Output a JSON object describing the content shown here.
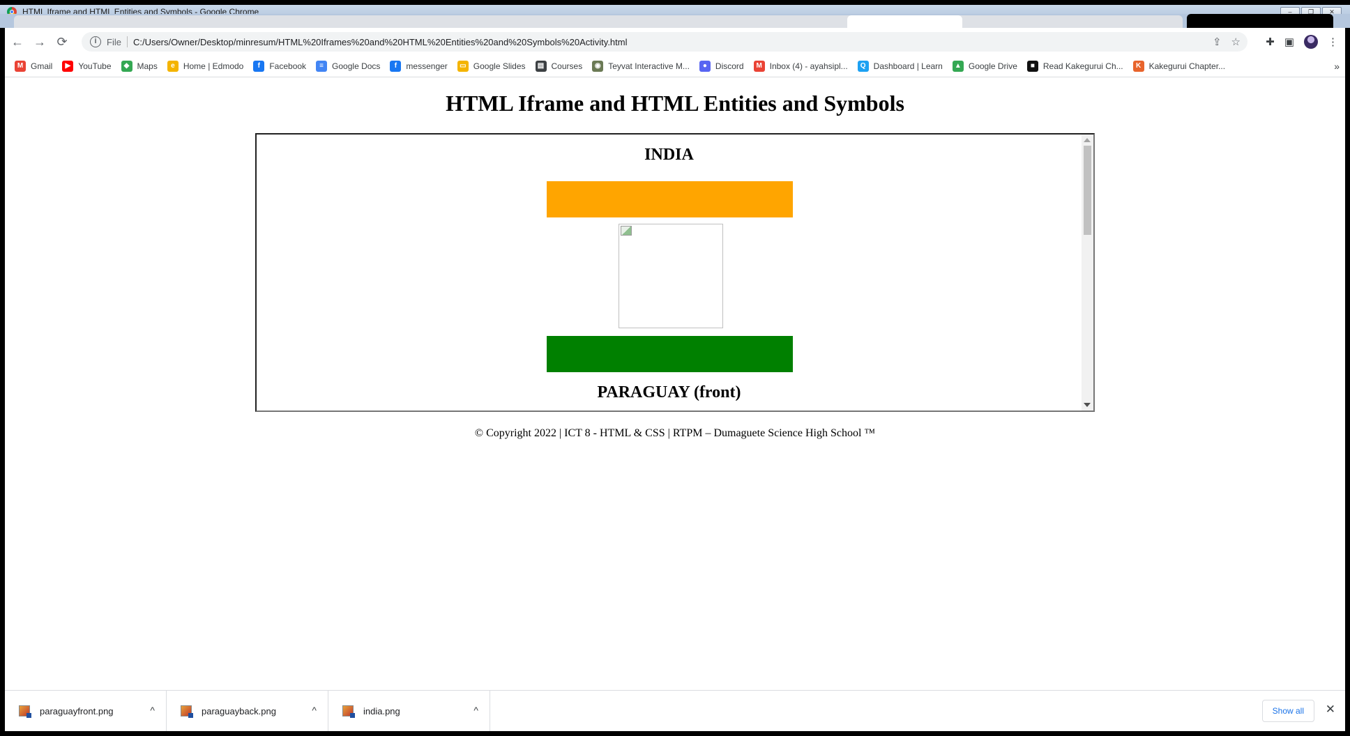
{
  "window": {
    "title": "HTML Iframe and HTML Entities and Symbols - Google Chrome",
    "controls": [
      "–",
      "❐",
      "✕"
    ]
  },
  "toolbar": {
    "back": "←",
    "forward": "→",
    "reload": "⟳",
    "info_icon": "i",
    "protocol": "File",
    "url": "C:/Users/Owner/Desktop/minresum/HTML%20Iframes%20and%20HTML%20Entities%20and%20Symbols%20Activity.html",
    "share": "⇪",
    "star": "☆",
    "extensions": "✚",
    "sidepanel": "▣",
    "menu": "⋮"
  },
  "bookmarks": [
    {
      "label": "Gmail",
      "icon": "M",
      "color": "#ea4335"
    },
    {
      "label": "YouTube",
      "icon": "▶",
      "color": "#ff0000"
    },
    {
      "label": "Maps",
      "icon": "◆",
      "color": "#34a853"
    },
    {
      "label": "Home | Edmodo",
      "icon": "e",
      "color": "#f4b400"
    },
    {
      "label": "Facebook",
      "icon": "f",
      "color": "#1877f2"
    },
    {
      "label": "Google Docs",
      "icon": "≡",
      "color": "#4285f4"
    },
    {
      "label": "messenger",
      "icon": "f",
      "color": "#1877f2"
    },
    {
      "label": "Google Slides",
      "icon": "▭",
      "color": "#f4b400"
    },
    {
      "label": "Courses",
      "icon": "▤",
      "color": "#3c4043"
    },
    {
      "label": "Teyvat Interactive M...",
      "icon": "◉",
      "color": "#6b7a55"
    },
    {
      "label": "Discord",
      "icon": "●",
      "color": "#5865f2"
    },
    {
      "label": "Inbox (4) - ayahsipl...",
      "icon": "M",
      "color": "#ea4335"
    },
    {
      "label": "Dashboard | Learn",
      "icon": "Q",
      "color": "#1da1f2"
    },
    {
      "label": "Google Drive",
      "icon": "▲",
      "color": "#34a853"
    },
    {
      "label": "Read Kakegurui Ch...",
      "icon": "■",
      "color": "#111111"
    },
    {
      "label": "Kakegurui Chapter...",
      "icon": "K",
      "color": "#e8642c"
    }
  ],
  "bookmarks_more": "»",
  "page": {
    "heading": "HTML Iframe and HTML Entities and Symbols",
    "iframe": {
      "country1": "INDIA",
      "country2": "PARAGUAY (front)",
      "colors": {
        "saffron": "#ffa500",
        "green": "#008000"
      }
    },
    "footer": "© Copyright 2022 | ICT 8 - HTML & CSS | RTPM – Dumaguete Science High School ™"
  },
  "downloads": {
    "items": [
      {
        "name": "paraguayfront.png",
        "chevron": "^"
      },
      {
        "name": "paraguayback.png",
        "chevron": "^"
      },
      {
        "name": "india.png",
        "chevron": "^"
      }
    ],
    "show_all": "Show all",
    "close": "✕"
  }
}
